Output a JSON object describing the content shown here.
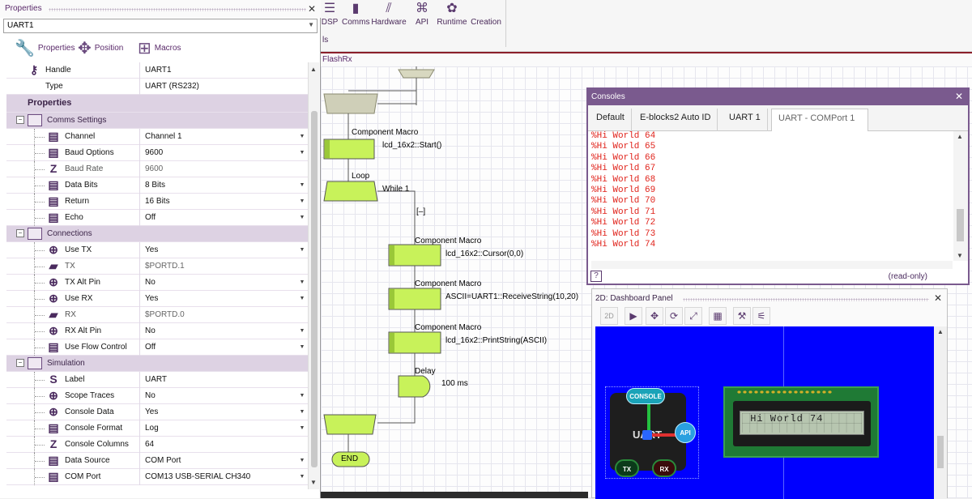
{
  "ribbon": {
    "buttons": [
      {
        "label": "DSP",
        "icon": "dsp-icon"
      },
      {
        "label": "Comms",
        "icon": "comms-icon"
      },
      {
        "label": "Hardware",
        "icon": "hardware-icon"
      },
      {
        "label": "API",
        "icon": "api-icon"
      },
      {
        "label": "Runtime",
        "icon": "runtime-icon"
      },
      {
        "label": "Creation",
        "icon": "creation-icon"
      }
    ],
    "group_label": "ls"
  },
  "document_tab": "FlashRx",
  "properties": {
    "title": "Properties",
    "selected_component": "UART1",
    "tabs": [
      {
        "label": "Properties",
        "icon": "wrench-icon"
      },
      {
        "label": "Position",
        "icon": "move-icon"
      },
      {
        "label": "Macros",
        "icon": "macros-icon"
      }
    ],
    "top_rows": [
      {
        "label": "Handle",
        "value": "UART1"
      },
      {
        "label": "Type",
        "value": "UART (RS232)"
      }
    ],
    "header": "Properties",
    "sections": [
      {
        "title": "Comms Settings",
        "rows": [
          {
            "label": "Channel",
            "value": "Channel 1",
            "dropdown": true
          },
          {
            "label": "Baud Options",
            "value": "9600",
            "dropdown": true
          },
          {
            "label": "Baud Rate",
            "value": "9600",
            "dropdown": false,
            "disabled": true
          },
          {
            "label": "Data Bits",
            "value": "8 Bits",
            "dropdown": true
          },
          {
            "label": "Return",
            "value": "16 Bits",
            "dropdown": true
          },
          {
            "label": "Echo",
            "value": "Off",
            "dropdown": true
          }
        ]
      },
      {
        "title": "Connections",
        "rows": [
          {
            "label": "Use TX",
            "value": "Yes",
            "dropdown": true
          },
          {
            "label": "TX",
            "value": "$PORTD.1",
            "dropdown": false,
            "disabled": true
          },
          {
            "label": "TX Alt Pin",
            "value": "No",
            "dropdown": true
          },
          {
            "label": "Use RX",
            "value": "Yes",
            "dropdown": true
          },
          {
            "label": "RX",
            "value": "$PORTD.0",
            "dropdown": false,
            "disabled": true
          },
          {
            "label": "RX Alt Pin",
            "value": "No",
            "dropdown": true
          },
          {
            "label": "Use Flow Control",
            "value": "Off",
            "dropdown": true
          }
        ]
      },
      {
        "title": "Simulation",
        "rows": [
          {
            "label": "Label",
            "value": "UART",
            "dropdown": false
          },
          {
            "label": "Scope Traces",
            "value": "No",
            "dropdown": true
          },
          {
            "label": "Console Data",
            "value": "Yes",
            "dropdown": true
          },
          {
            "label": "Console Format",
            "value": "Log",
            "dropdown": true
          },
          {
            "label": "Console Columns",
            "value": "64",
            "dropdown": false
          },
          {
            "label": "Data Source",
            "value": "COM Port",
            "dropdown": true
          },
          {
            "label": "COM Port",
            "value": "COM13 USB-SERIAL CH340",
            "dropdown": true
          }
        ]
      }
    ]
  },
  "flowchart": {
    "blocks": [
      {
        "kind": "Component Macro",
        "text": "lcd_16x2::Start()"
      },
      {
        "kind": "Loop",
        "text": "While 1"
      },
      {
        "kind": "",
        "text": "[–]"
      },
      {
        "kind": "Component Macro",
        "text": "lcd_16x2::Cursor(0,0)"
      },
      {
        "kind": "Component Macro",
        "text": "ASCII=UART1::ReceiveString(10,20)"
      },
      {
        "kind": "Component Macro",
        "text": "lcd_16x2::PrintString(ASCII)"
      },
      {
        "kind": "Delay",
        "text": "100 ms"
      }
    ],
    "end_label": "END"
  },
  "consoles": {
    "title": "Consoles",
    "tabs": [
      "Default",
      "E-blocks2 Auto ID",
      "UART 1",
      "UART - COMPort 1"
    ],
    "active_tab": 3,
    "lines": [
      "%Hi World 64",
      "%Hi World 65",
      "%Hi World 66",
      "%Hi World 67",
      "%Hi World 68",
      "%Hi World 69",
      "%Hi World 70",
      "%Hi World 71",
      "%Hi World 72",
      "%Hi World 73",
      "%Hi World 74"
    ],
    "status": "(read-only)",
    "help_label": "?"
  },
  "dashboard": {
    "title": "2D: Dashboard Panel",
    "toolbar": [
      "2d-view-icon",
      "pointer-icon",
      "move-icon",
      "rotate-icon",
      "resize-icon",
      "panel-icon",
      "wrench-icon",
      "probe-icon"
    ],
    "toolbar_2d_label": "2D",
    "uart_component": {
      "name": "UART",
      "console_label": "CONSOLE",
      "api_label": "API",
      "tx_label": "TX",
      "rx_label": "RX"
    },
    "lcd_text": " Hi World 74"
  },
  "colors": {
    "accent": "#7a5a8e",
    "flow_block": "#c8f25a",
    "console_text": "#e0221a",
    "dashboard_bg": "#0000ff"
  }
}
